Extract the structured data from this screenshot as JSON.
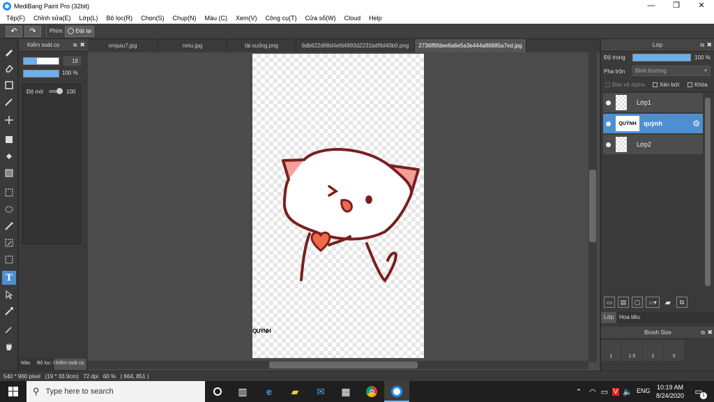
{
  "window": {
    "title": "MediBang Paint Pro (32bit)",
    "minimize": "—",
    "maximize": "❐",
    "close": "✕"
  },
  "menu": [
    "Tệp(F)",
    "Chỉnh sửa(E)",
    "Lớp(L)",
    "Bộ lọc(R)",
    "Chọn(S)",
    "Chụp(N)",
    "Màu (C)",
    "Xem(V)",
    "Công cụ(T)",
    "Cửa sổ(W)",
    "Cloud",
    "Help"
  ],
  "toolbar": {
    "undo_icon": "undo-icon",
    "redo_icon": "redo-icon",
    "key_label": "Phím",
    "reset_label": "Đặt lại"
  },
  "brush_panel": {
    "title": "Kiểm soát cọ",
    "size_value": "19",
    "opacity_value": "100 %",
    "blur_label": "Độ mờ",
    "blur_value": "100"
  },
  "bottom_left_tabs": [
    "Màu",
    "Bộ lọc: B...",
    "Kiểm soát cọ"
  ],
  "tabs": [
    "nmjuiu7.jpg",
    "nmu.jpg",
    "tải xuống.png",
    "6db622d98d4efd4993d2231bdf9d40b0.png",
    "2736ff6fdee6a6e5a3e444a86885a7ed.jpg"
  ],
  "active_tab_index": 4,
  "canvas": {
    "text_layer": "QUỲNH"
  },
  "layers_panel": {
    "title": "Lớp",
    "opacity_label": "Độ trong",
    "opacity_value": "100 %",
    "blend_label": "Pha trộn",
    "blend_value": "Bình thường",
    "protect_alpha": "Bảo vệ alpha",
    "clip": "Xén bớt",
    "lock": "Khóa",
    "layers": [
      {
        "name": "Lớp1",
        "selected": false
      },
      {
        "name": "quỳnh",
        "selected": true,
        "thumb_text": "QUỲNH"
      },
      {
        "name": "Lớp2",
        "selected": false
      }
    ],
    "tabs": [
      "Lớp",
      "Hoa tiêu"
    ],
    "brush_size_title": "Brush Size",
    "brush_sizes": [
      "1",
      "1.5",
      "2",
      "3"
    ]
  },
  "status": {
    "text": "540 * 960 pixel   (19 * 33.9cm)   72 dpi   60 %   ( 664, 851 )"
  },
  "taskbar": {
    "search_placeholder": "Type here to search",
    "lang": "ENG",
    "time": "10:19 AM",
    "date": "8/24/2020",
    "notif_count": "1"
  },
  "colors": {
    "accent": "#4d8fd1",
    "panel": "#3a3a3a",
    "cat_outline": "#7a1f1f",
    "cat_blush": "#f4a09a"
  }
}
